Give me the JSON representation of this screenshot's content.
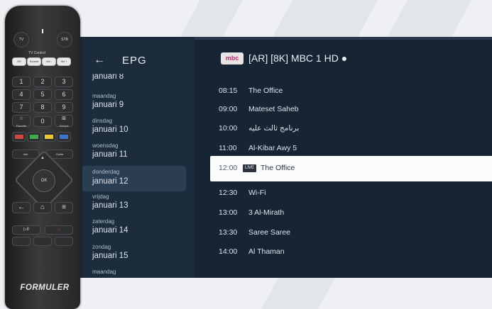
{
  "epg_app": {
    "back_icon": "arrow-left-icon",
    "title": "EPG",
    "dates": [
      {
        "day": "",
        "date": "januari 8"
      },
      {
        "day": "maandag",
        "date": "januari 9"
      },
      {
        "day": "dinsdag",
        "date": "januari 10"
      },
      {
        "day": "woensdag",
        "date": "januari 11"
      },
      {
        "day": "donderdag",
        "date": "januari 12"
      },
      {
        "day": "vrijdag",
        "date": "januari 13"
      },
      {
        "day": "zaterdag",
        "date": "januari 14"
      },
      {
        "day": "zondag",
        "date": "januari 15"
      },
      {
        "day": "maandag",
        "date": ""
      }
    ],
    "selected_date": "januari 12",
    "channel": {
      "logo_text": "mbc",
      "name": "[AR] [8K] MBC 1 HD ●"
    },
    "programs": [
      {
        "time": "08:15",
        "title": "The Office"
      },
      {
        "time": "09:00",
        "title": "Mateset Saheb"
      },
      {
        "time": "10:00",
        "title": "برنامج ثالث عليه"
      },
      {
        "time": "11:00",
        "title": "Al-Kibar Awy 5"
      },
      {
        "time": "12:00",
        "title": "The Office",
        "badge": "LIVE"
      },
      {
        "time": "12:30",
        "title": "Wi-Fi"
      },
      {
        "time": "13:00",
        "title": "3 Al-Mirath"
      },
      {
        "time": "13:30",
        "title": "Saree Saree"
      },
      {
        "time": "14:00",
        "title": "Al Thaman"
      }
    ]
  },
  "remote": {
    "tv_label": "TV",
    "stb_label": "STB",
    "tv_control_label": "TV Control",
    "tv_buttons": [
      "OK",
      "Source",
      "Vol -",
      "Vol +"
    ],
    "numbers": [
      "1",
      "2",
      "3",
      "4",
      "5",
      "6",
      "7",
      "8",
      "9",
      "☆",
      "0",
      "⊞"
    ],
    "favorite_label": "Favorite",
    "groups_label": "Groups",
    "color_keys": [
      "#d0473b",
      "#41a84b",
      "#e6c63a",
      "#3f74c8"
    ],
    "info_label": "Info",
    "guide_label": "Guide",
    "ok_label": "OK",
    "nav": [
      "←",
      "⌂",
      "≡"
    ],
    "play_pause": "▷II",
    "record": "○",
    "brand": "FORMULER"
  }
}
